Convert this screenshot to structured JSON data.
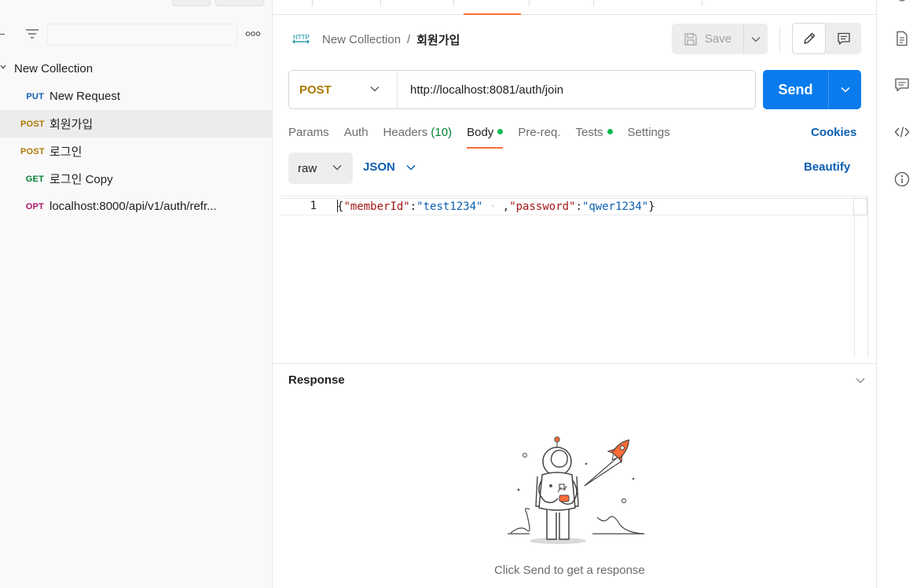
{
  "sidebar": {
    "collection": {
      "name": "New Collection"
    },
    "requests": [
      {
        "method": "PUT",
        "name": "New Request",
        "selected": false
      },
      {
        "method": "POST",
        "name": "회원가입",
        "selected": true
      },
      {
        "method": "POST",
        "name": "로그인",
        "selected": false
      },
      {
        "method": "GET",
        "name": "로그인 Copy",
        "selected": false
      },
      {
        "method": "OPT",
        "name": "localhost:8000/api/v1/auth/refr...",
        "selected": false
      }
    ]
  },
  "header": {
    "breadcrumb_parent": "New Collection",
    "breadcrumb_separator": "/",
    "breadcrumb_current": "회원가입",
    "save_label": "Save"
  },
  "request": {
    "method": "POST",
    "url": "http://localhost:8081/auth/join",
    "send_label": "Send"
  },
  "tabs": {
    "params": "Params",
    "auth": "Auth",
    "headers": "Headers",
    "headers_count": "(10)",
    "body": "Body",
    "prereq": "Pre-req.",
    "tests": "Tests",
    "settings": "Settings",
    "cookies": "Cookies"
  },
  "body": {
    "mode": "raw",
    "language": "JSON",
    "beautify": "Beautify",
    "line_number": "1",
    "tokens": {
      "open": "{",
      "k1": "\"memberId\"",
      "c1": ":",
      "v1": "\"test1234\"",
      "ws": " · ",
      "comma": ",",
      "k2": "\"password\"",
      "c2": ":",
      "v2": "\"qwer1234\"",
      "close": "}"
    }
  },
  "response": {
    "title": "Response",
    "hint": "Click Send to get a response"
  },
  "colors": {
    "accent_orange": "#ff6c37",
    "send_blue": "#097bed",
    "link_blue": "#0b5fb2",
    "post_method": "#ad7a03",
    "put_method": "#0b5fb2",
    "get_method": "#007f31",
    "opt_method": "#a61468",
    "status_green": "#0cbb52"
  },
  "icons": {
    "filter": "filter-icon",
    "more": "more-horizontal-icon",
    "http": "http-request-icon",
    "save": "floppy-disk-icon",
    "edit": "pencil-icon",
    "comment": "comment-icon",
    "docs": "document-icon",
    "code": "code-icon",
    "info": "info-icon"
  }
}
